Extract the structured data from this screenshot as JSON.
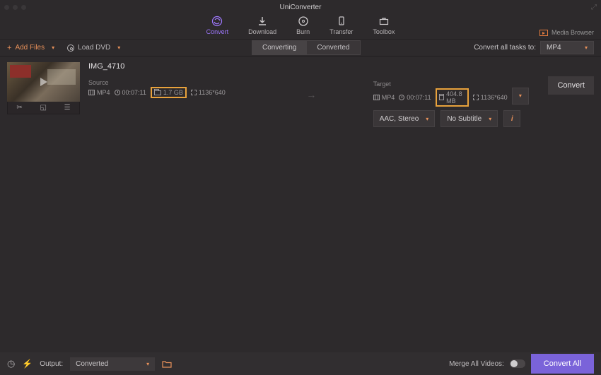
{
  "window": {
    "title": "UniConverter"
  },
  "toolbar": {
    "convert": "Convert",
    "download": "Download",
    "burn": "Burn",
    "transfer": "Transfer",
    "toolbox": "Toolbox",
    "media_browser": "Media Browser"
  },
  "subbar": {
    "add_files": "Add Files",
    "load_dvd": "Load DVD",
    "tab_converting": "Converting",
    "tab_converted": "Converted",
    "convert_all_label": "Convert all tasks to:",
    "format": "MP4"
  },
  "file": {
    "name": "IMG_4710",
    "source": {
      "label": "Source",
      "format": "MP4",
      "duration": "00:07:11",
      "size": "1.7 GB",
      "resolution": "1136*640"
    },
    "target": {
      "label": "Target",
      "format": "MP4",
      "duration": "00:07:11",
      "size": "404.8 MB",
      "resolution": "1136*640",
      "audio": "AAC, Stereo",
      "subtitle": "No Subtitle"
    },
    "convert_btn": "Convert"
  },
  "bottom": {
    "output_label": "Output:",
    "output_value": "Converted",
    "merge_label": "Merge All Videos:",
    "convert_all": "Convert All"
  }
}
